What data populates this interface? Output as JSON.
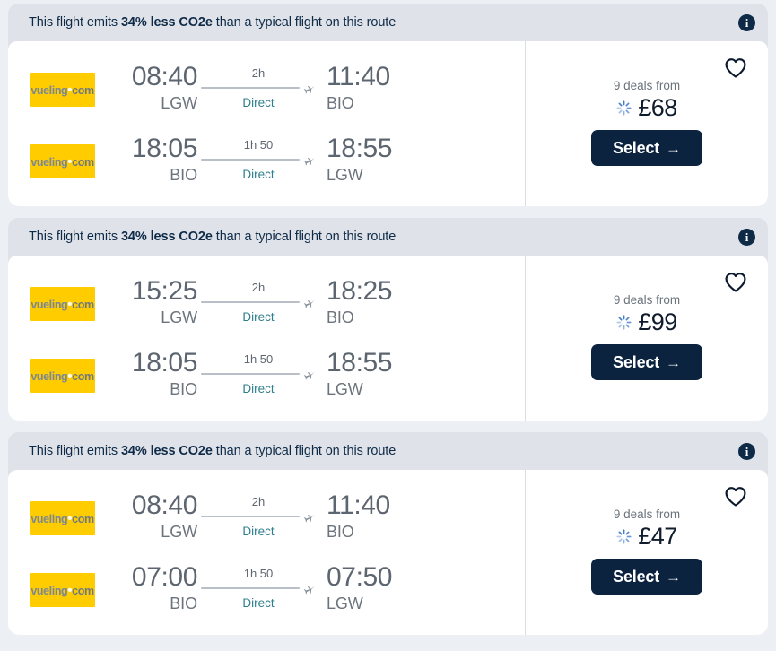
{
  "page": {
    "background_color": "#eceff4",
    "accent_navy": "#0c2340",
    "teal": "#2e7f8d",
    "logo_yellow": "#ffcc00"
  },
  "cards": [
    {
      "eco_banner": {
        "text_before": "This flight emits ",
        "highlight": "34% less CO2e",
        "text_after": " than a typical flight on this route",
        "info_icon": "info-icon",
        "info_glyph": "i"
      },
      "legs": [
        {
          "airline": "vueling",
          "logo_word": "vueling",
          "logo_dot": "•",
          "logo_suffix": "com",
          "depart_time": "08:40",
          "depart_airport": "LGW",
          "duration": "2h",
          "stops": "Direct",
          "arrive_time": "11:40",
          "arrive_airport": "BIO"
        },
        {
          "airline": "vueling",
          "logo_word": "vueling",
          "logo_dot": "•",
          "logo_suffix": "com",
          "depart_time": "18:05",
          "depart_airport": "BIO",
          "duration": "1h 50",
          "stops": "Direct",
          "arrive_time": "18:55",
          "arrive_airport": "LGW"
        }
      ],
      "price_panel": {
        "deals_label": "9 deals from",
        "price": "£68",
        "select_label": "Select",
        "select_arrow": "→",
        "favorite_icon": "heart-icon",
        "loading_icon": "spinner-icon"
      }
    },
    {
      "eco_banner": {
        "text_before": "This flight emits ",
        "highlight": "34% less CO2e",
        "text_after": " than a typical flight on this route",
        "info_icon": "info-icon",
        "info_glyph": "i"
      },
      "legs": [
        {
          "airline": "vueling",
          "logo_word": "vueling",
          "logo_dot": "•",
          "logo_suffix": "com",
          "depart_time": "15:25",
          "depart_airport": "LGW",
          "duration": "2h",
          "stops": "Direct",
          "arrive_time": "18:25",
          "arrive_airport": "BIO"
        },
        {
          "airline": "vueling",
          "logo_word": "vueling",
          "logo_dot": "•",
          "logo_suffix": "com",
          "depart_time": "18:05",
          "depart_airport": "BIO",
          "duration": "1h 50",
          "stops": "Direct",
          "arrive_time": "18:55",
          "arrive_airport": "LGW"
        }
      ],
      "price_panel": {
        "deals_label": "9 deals from",
        "price": "£99",
        "select_label": "Select",
        "select_arrow": "→",
        "favorite_icon": "heart-icon",
        "loading_icon": "spinner-icon"
      }
    },
    {
      "eco_banner": {
        "text_before": "This flight emits ",
        "highlight": "34% less CO2e",
        "text_after": " than a typical flight on this route",
        "info_icon": "info-icon",
        "info_glyph": "i"
      },
      "legs": [
        {
          "airline": "vueling",
          "logo_word": "vueling",
          "logo_dot": "•",
          "logo_suffix": "com",
          "depart_time": "08:40",
          "depart_airport": "LGW",
          "duration": "2h",
          "stops": "Direct",
          "arrive_time": "11:40",
          "arrive_airport": "BIO"
        },
        {
          "airline": "vueling",
          "logo_word": "vueling",
          "logo_dot": "•",
          "logo_suffix": "com",
          "depart_time": "07:00",
          "depart_airport": "BIO",
          "duration": "1h 50",
          "stops": "Direct",
          "arrive_time": "07:50",
          "arrive_airport": "LGW"
        }
      ],
      "price_panel": {
        "deals_label": "9 deals from",
        "price": "£47",
        "select_label": "Select",
        "select_arrow": "→",
        "favorite_icon": "heart-icon",
        "loading_icon": "spinner-icon"
      }
    }
  ]
}
